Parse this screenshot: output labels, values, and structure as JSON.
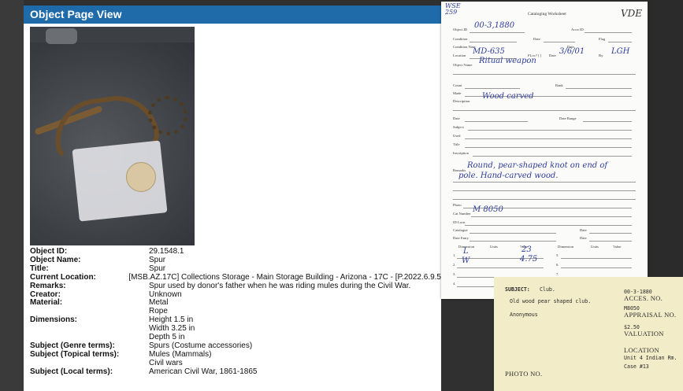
{
  "page": {
    "header_title": "Object Page View",
    "fields": [
      {
        "label": "Object ID:",
        "values": [
          "29.1548.1"
        ]
      },
      {
        "label": "Object Name:",
        "values": [
          "Spur"
        ]
      },
      {
        "label": "Title:",
        "values": [
          "Spur"
        ]
      },
      {
        "label": "Current Location:",
        "values": [
          "[MSB.AZ.17C] Collections Storage - Main Storage Building - Arizona - 17C - [P.2022.6.9.5"
        ]
      },
      {
        "label": "Remarks:",
        "values": [
          "Spur used by donor's father when he was riding mules during the Civil War."
        ]
      },
      {
        "label": "Creator:",
        "values": [
          "Unknown"
        ]
      },
      {
        "label": "Material:",
        "values": [
          "Metal",
          "Rope"
        ]
      },
      {
        "label": "Dimensions:",
        "values": [
          "Height 1.5 in",
          "Width 3.25 in",
          "Depth 5 in"
        ]
      },
      {
        "label": "Subject (Genre terms):",
        "values": [
          "Spurs (Costume accessories)"
        ]
      },
      {
        "label": "Subject (Topical terms):",
        "values": [
          "Mules (Mammals)",
          "Civil wars"
        ]
      },
      {
        "label": "Subject (Local terms):",
        "values": [
          "American Civil War, 1861-1865"
        ]
      }
    ]
  },
  "worksheet": {
    "corner_note": "WSE 259",
    "title": "Cataloging Worksheet",
    "initials": "VDE",
    "object_id_label": "Object ID",
    "object_id_value": "00-3,1880",
    "accn_label": "Accn ID",
    "condition_label": "Condition",
    "date_label": "Date",
    "flag_label": "Flag",
    "condition_note_label": "Condition Note",
    "location_label": "Location",
    "location_value": "MD-635",
    "flag_hw_label": "FLoc? [ ]",
    "loc_date_value": "3/6/01",
    "by_label": "By",
    "by_value": "LGH",
    "object_name_label": "Object Name",
    "object_name_value": "Ritual weapon",
    "count_label": "Count",
    "rank_label": "Rank",
    "made_label": "Made",
    "description_label": "Description",
    "description_value": "Wood carved",
    "date2_label": "Date",
    "date_range_label": "Date Range",
    "subject_label": "Subject",
    "used_label": "Used",
    "title_label": "Title",
    "inscription_label": "Inscription",
    "remarks_label": "Remarks",
    "remarks_value_1": "Round, pear-shaped knot on end of",
    "remarks_value_2": "pole. Hand-carved wood.",
    "photo_label": "Photo",
    "cat_number_label": "Cat Number",
    "cat_number_value": "M 8050",
    "id_loc_label": "ID Locn",
    "catalogue_label": "Catalogue",
    "date_entry_label": "Date Entry",
    "dim_headers": [
      "Dimension",
      "Units",
      "Value",
      "Dimension",
      "Units",
      "Value"
    ],
    "dim_rows": [
      {
        "num": "1.",
        "dim": "L",
        "value": "23"
      },
      {
        "num": "2.",
        "dim": "W",
        "value": "4.75"
      },
      {
        "num": "3.",
        "dim": "",
        "value": ""
      },
      {
        "num": "4.",
        "dim": "",
        "value": ""
      }
    ]
  },
  "card": {
    "subject_label": "SUBJECT:",
    "subject_value": "Club.",
    "description": "Old wood pear shaped club.",
    "donor": "Anonymous",
    "accession_number": "00-3-1880",
    "accession_label": "ACCES. NO.",
    "appraisal_number": "M8050",
    "appraisal_label": "APPRAISAL NO.",
    "valuation_value": "$2.50",
    "valuation_label": "VALUATION",
    "location_label": "LOCATION",
    "location_value_1": "Unit 4 Indian Rm.",
    "location_value_2": "Case #13",
    "photo_label": "PHOTO NO."
  }
}
